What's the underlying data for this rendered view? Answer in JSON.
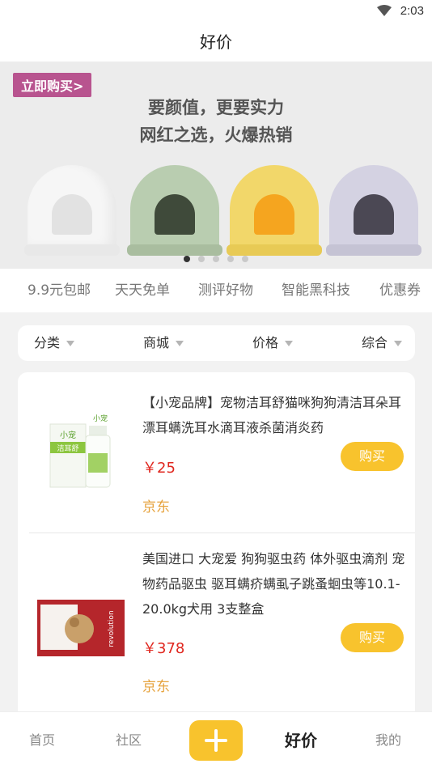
{
  "status_bar": {
    "time": "2:03",
    "icon": "wifi-icon"
  },
  "header": {
    "title": "好价"
  },
  "banner": {
    "buy_tag": "立即购买>",
    "headline_line1": "要颜值，更要实力",
    "headline_line2": "网红之选，火爆热销",
    "carousel_page": 1,
    "carousel_total": 5,
    "colors": {
      "white": "#f4f4f4",
      "green": "#b9cdb0",
      "yellow": "#f2d76a",
      "lavender": "#d4d2e2"
    }
  },
  "categories": [
    "9.9元包邮",
    "天天免单",
    "测评好物",
    "智能黑科技",
    "优惠券"
  ],
  "filters": [
    "分类",
    "商城",
    "价格",
    "综合"
  ],
  "products": [
    {
      "title": "【小宠品牌】宠物洁耳舒猫咪狗狗清洁耳朵耳漂耳螨洗耳水滴耳液杀菌消炎药",
      "price": "￥25",
      "buy_label": "购买",
      "source": "京东",
      "image_brand": "小宠",
      "image_name": "洁耳舒"
    },
    {
      "title": "美国进口 大宠爱 狗狗驱虫药 体外驱虫滴剂 宠物药品驱虫 驱耳螨疥螨虱子跳蚤蛔虫等10.1-20.0kg犬用 3支整盒",
      "price": "￥378",
      "buy_label": "购买",
      "source": "京东",
      "image_brand": "revolution"
    }
  ],
  "tabs": [
    "首页",
    "社区",
    "好价",
    "我的"
  ],
  "active_tab": "好价",
  "accent_color": "#f8c32d",
  "price_color": "#e0271f"
}
